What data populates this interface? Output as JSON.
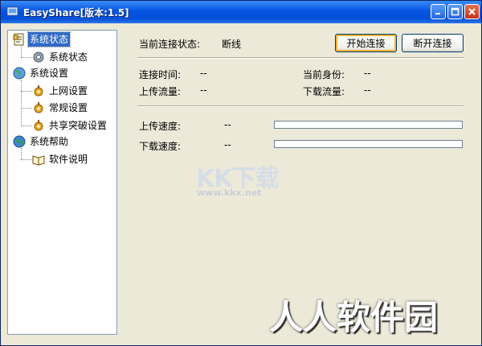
{
  "window": {
    "title": "EasyShare[版本:1.5]"
  },
  "tree": {
    "groups": [
      {
        "label": "系统状态",
        "children": [
          {
            "label": "系统状态"
          }
        ]
      },
      {
        "label": "系统设置",
        "children": [
          {
            "label": "上网设置"
          },
          {
            "label": "常规设置"
          },
          {
            "label": "共享突破设置"
          }
        ]
      },
      {
        "label": "系统帮助",
        "children": [
          {
            "label": "软件说明"
          }
        ]
      }
    ]
  },
  "status": {
    "connection_label": "当前连接状态:",
    "connection_value": "断线",
    "connect_button": "开始连接",
    "disconnect_button": "断开连接",
    "connect_time_label": "连接时间:",
    "connect_time_value": "--",
    "identity_label": "当前身份:",
    "identity_value": "--",
    "upload_traffic_label": "上传流量:",
    "upload_traffic_value": "--",
    "download_traffic_label": "下载流量:",
    "download_traffic_value": "--",
    "upload_speed_label": "上传速度:",
    "upload_speed_value": "--",
    "upload_progress": 0,
    "download_speed_label": "下载速度:",
    "download_speed_value": "--",
    "download_progress": 0
  },
  "watermarks": {
    "kk": "KK下载",
    "kk_url": "www.kkx.net",
    "rr": "人人软件园"
  }
}
